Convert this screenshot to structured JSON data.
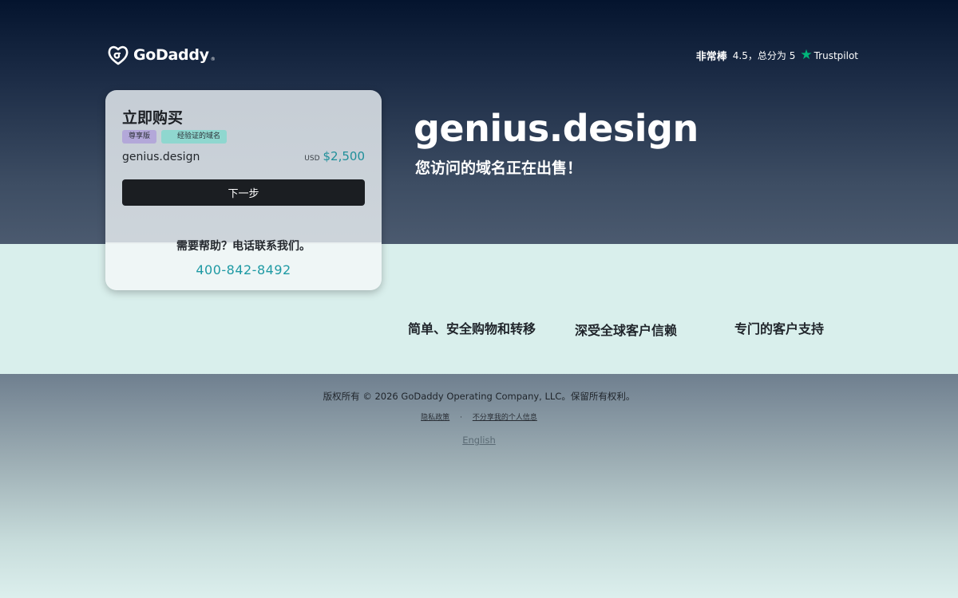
{
  "header": {
    "logo_text": "GoDaddy",
    "rating_word": "非常棒",
    "rating_score": "4.5，总分为 5",
    "rating_brand": "Trustpilot"
  },
  "card": {
    "title": "立即购买",
    "badge_premium": "尊享版",
    "badge_verified": "经验证的域名",
    "domain": "genius.design",
    "currency": "USD",
    "price": "$2,500",
    "next_button": "下一步",
    "help_text": "需要帮助？电话联系我们。",
    "phone": "400-842-8492"
  },
  "hero": {
    "domain": "genius.design",
    "subtitle": "您访问的域名正在出售！"
  },
  "features": [
    "简单、安全购物和转移",
    "深受全球客户信赖",
    "专门的客户支持"
  ],
  "footer": {
    "copyright": "版权所有 © 2026 GoDaddy Operating Company, LLC。保留所有权利。",
    "privacy": "隐私政策",
    "separator": "·",
    "do_not_share": "不分享我的个人信息",
    "language": "English"
  },
  "colors": {
    "accent_teal": "#1f8f9a",
    "trustpilot_green": "#00b67a",
    "badge_premium": "#b3a8d9",
    "badge_verified": "#8fd7cf"
  }
}
